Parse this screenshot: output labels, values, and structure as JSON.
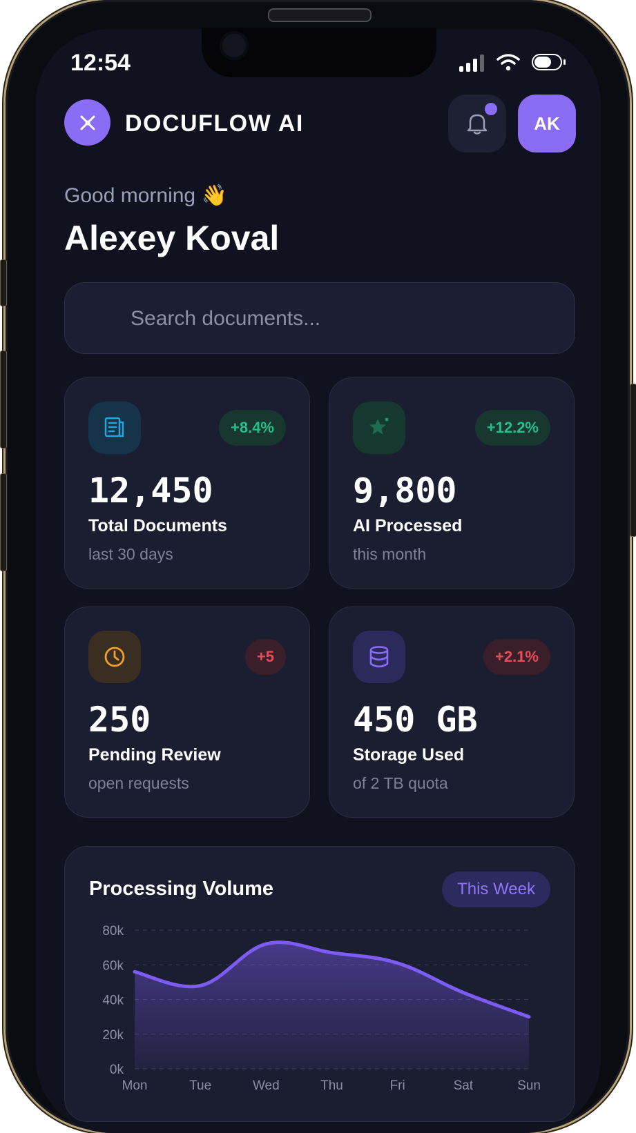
{
  "status_bar": {
    "time": "12:54"
  },
  "header": {
    "brand": "DOCUFLOW AI",
    "avatar_initials": "AK"
  },
  "greeting": {
    "line": "Good morning 👋",
    "name": "Alexey Koval"
  },
  "search": {
    "placeholder": "Search documents..."
  },
  "stats": [
    {
      "value": "12,450",
      "label": "Total Documents",
      "sub": "last 30 days",
      "change": "+8.4%",
      "icon": "document-icon",
      "accent": "#22a6d9",
      "change_color": "#22c08a"
    },
    {
      "value": "9,800",
      "label": "AI Processed",
      "sub": "this month",
      "change": "+12.2%",
      "icon": "star-icon",
      "accent": "#1f9a6c",
      "change_color": "#22c08a"
    },
    {
      "value": "250",
      "label": "Pending Review",
      "sub": "open requests",
      "change": "+5",
      "icon": "clock-icon",
      "accent": "#f0a22a",
      "change_color": "#e84d57"
    },
    {
      "value": "450 GB",
      "label": "Storage Used",
      "sub": "of 2 TB quota",
      "change": "+2.1%",
      "icon": "database-icon",
      "accent": "#8a6cf5",
      "change_color": "#e84d57"
    }
  ],
  "chart": {
    "title": "Processing Volume",
    "range_label": "This Week"
  },
  "chart_data": {
    "type": "area",
    "title": "Processing Volume",
    "categories": [
      "Mon",
      "Tue",
      "Wed",
      "Thu",
      "Fri",
      "Sat",
      "Sun"
    ],
    "series": [
      {
        "values": [
          56,
          48,
          72,
          67,
          61,
          44,
          30
        ]
      }
    ],
    "yticks": [
      "0k",
      "20k",
      "40k",
      "60k",
      "80k"
    ],
    "ylim": [
      0,
      80
    ],
    "grid": true,
    "accent": "#7c5cf5"
  },
  "colors": {
    "background": "#11121f",
    "card": "#1b1d30",
    "accent": "#8a6cf5"
  }
}
